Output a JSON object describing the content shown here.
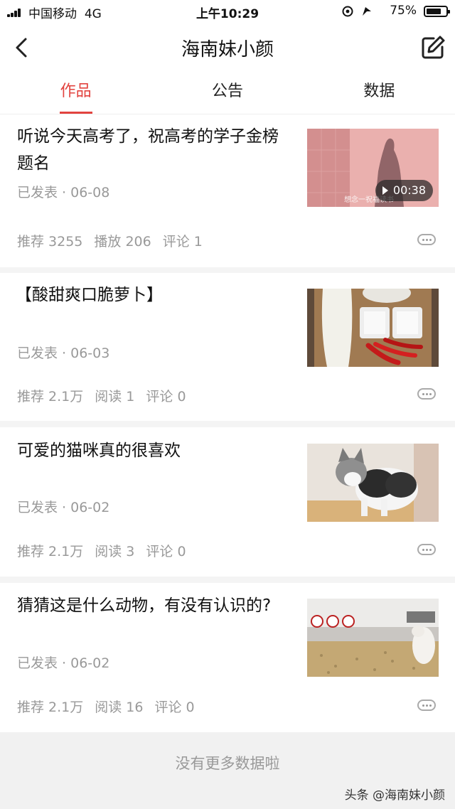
{
  "status_bar": {
    "carrier": "中国移动",
    "network": "4G",
    "time": "上午10:29",
    "battery": "75%",
    "battery_level": 0.75
  },
  "nav": {
    "back_icon": "chevron-left-icon",
    "title": "海南妹小颜",
    "edit_icon": "edit-icon"
  },
  "tabs": [
    {
      "label": "作品",
      "active": true
    },
    {
      "label": "公告",
      "active": false
    },
    {
      "label": "数据",
      "active": false
    }
  ],
  "posts": [
    {
      "title": "听说今天高考了，祝高考的学子金榜题名",
      "meta": "已发表 · 06-08",
      "stats": [
        "推荐 3255",
        "播放 206",
        "评论 1"
      ],
      "duration": "00:38",
      "thumb_caption": "想念一祝福读书"
    },
    {
      "title": "【酸甜爽口脆萝卜】",
      "meta": "已发表 · 06-03",
      "stats": [
        "推荐 2.1万",
        "阅读 1",
        "评论 0"
      ]
    },
    {
      "title": "可爱的猫咪真的很喜欢",
      "meta": "已发表 · 06-02",
      "stats": [
        "推荐 2.1万",
        "阅读 3",
        "评论 0"
      ]
    },
    {
      "title": "猜猜这是什么动物，有没有认识的?",
      "meta": "已发表 · 06-02",
      "stats": [
        "推荐 2.1万",
        "阅读 16",
        "评论 0"
      ]
    }
  ],
  "footer": {
    "no_more": "没有更多数据啦",
    "watermark": "头条 @海南妹小颜"
  },
  "colors": {
    "accent": "#e2433f",
    "muted_text": "#999999",
    "background": "#f4f4f4"
  }
}
